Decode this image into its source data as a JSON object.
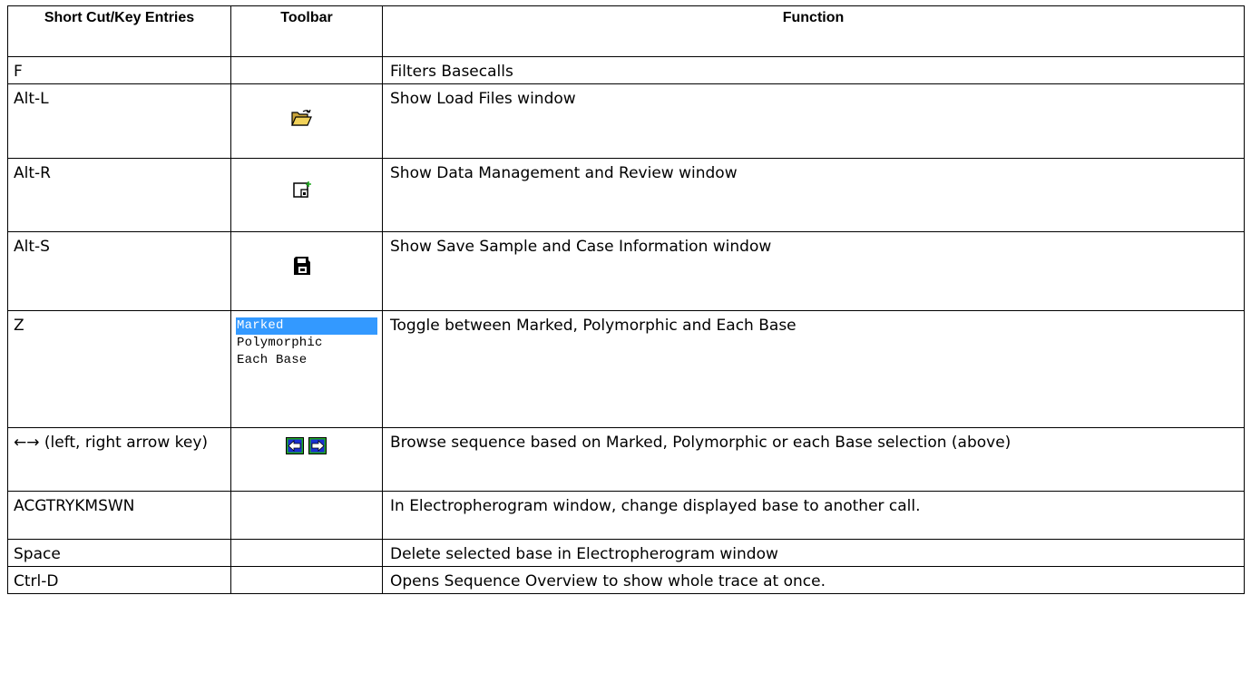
{
  "headers": {
    "key": "Short Cut/Key Entries",
    "toolbar": "Toolbar",
    "function": "Function"
  },
  "rows": [
    {
      "key": "F",
      "function": "Filters Basecalls",
      "icon": ""
    },
    {
      "key": "Alt-L",
      "function": "Show Load Files window",
      "icon": "open-folder-icon"
    },
    {
      "key": "Alt-R",
      "function": "Show Data Management and Review window",
      "icon": "data-review-icon"
    },
    {
      "key": "Alt-S",
      "function": "Show Save Sample and Case Information window",
      "icon": "save-disk-icon"
    },
    {
      "key": "Z",
      "function": "Toggle between Marked, Polymorphic and Each Base",
      "icon": "mode-list",
      "modes": [
        "Marked",
        "Polymorphic",
        "Each Base"
      ],
      "selected_mode": "Marked"
    },
    {
      "key": "←→ (left, right arrow key)",
      "function": "Browse sequence based on Marked, Polymorphic or each Base selection (above)",
      "icon": "left-right-arrow-icons"
    },
    {
      "key": "ACGTRYKMSWN",
      "function": "In Electropherogram window, change displayed base to another call.",
      "icon": ""
    },
    {
      "key": "Space",
      "function": "Delete selected base in Electropherogram window",
      "icon": ""
    },
    {
      "key": "Ctrl-D",
      "function": "Opens Sequence Overview to show whole trace at once.",
      "icon": ""
    }
  ],
  "colors": {
    "selection": "#3399ff",
    "arrow_green": "#1fa81f",
    "arrow_blue": "#1a2fd0",
    "folder_yellow": "#f2d25a"
  }
}
